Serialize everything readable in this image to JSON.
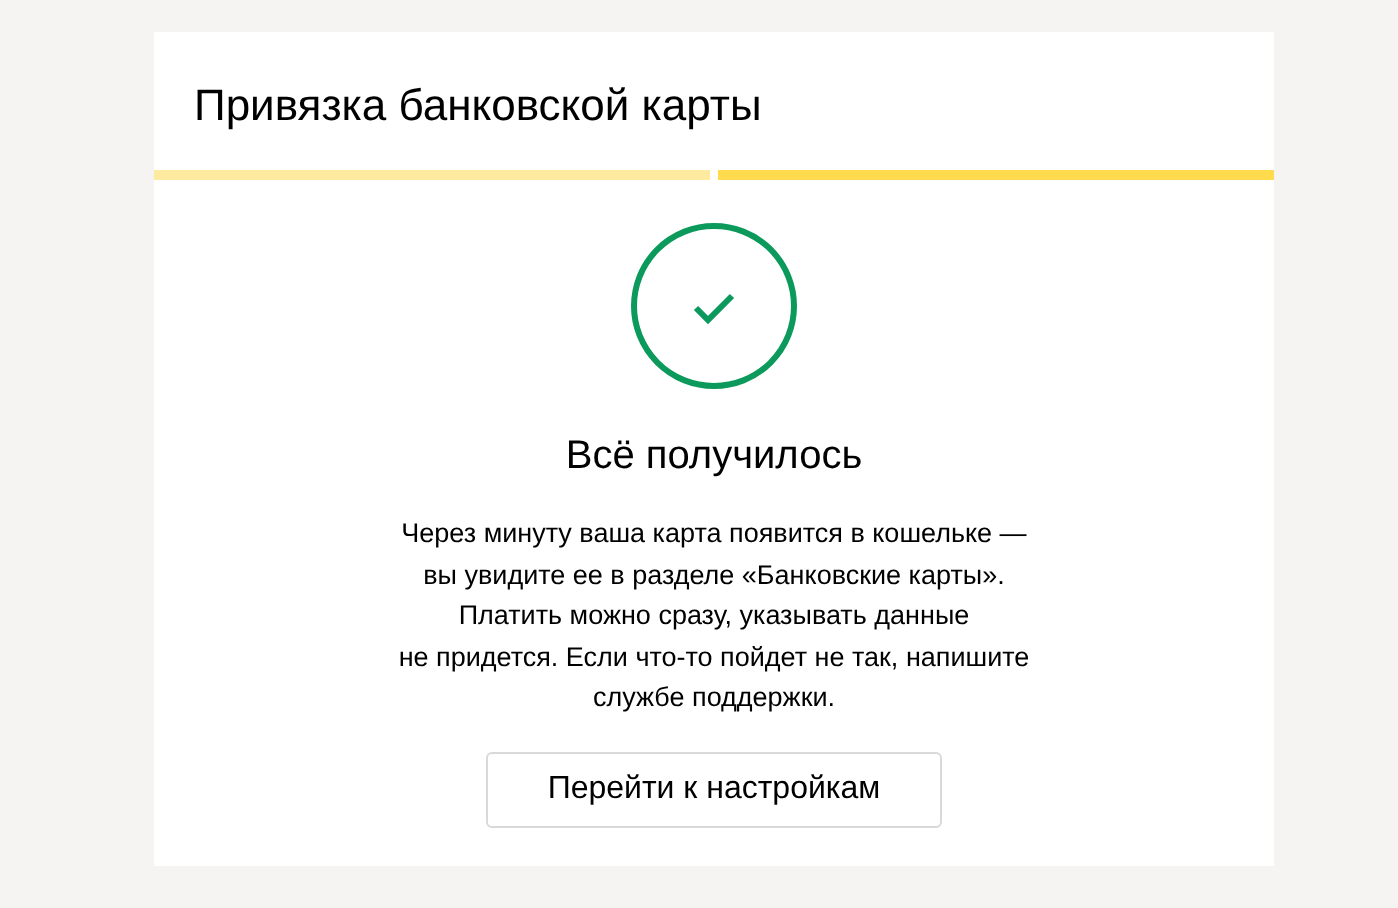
{
  "title": "Привязка банковской карты",
  "steps": [
    {
      "selected": false
    },
    {
      "selected": true
    }
  ],
  "status": {
    "kind": "success",
    "heading": "Всё получилось",
    "message": "Через минуту ваша карта появится в кошельке —\nвы увидите ее в разделе «Банковские карты».\nПлатить можно сразу, указывать данные\nне придется. Если что-то пойдет не так, напишите\nслужбе поддержки."
  },
  "button": "Перейти к настройкам"
}
